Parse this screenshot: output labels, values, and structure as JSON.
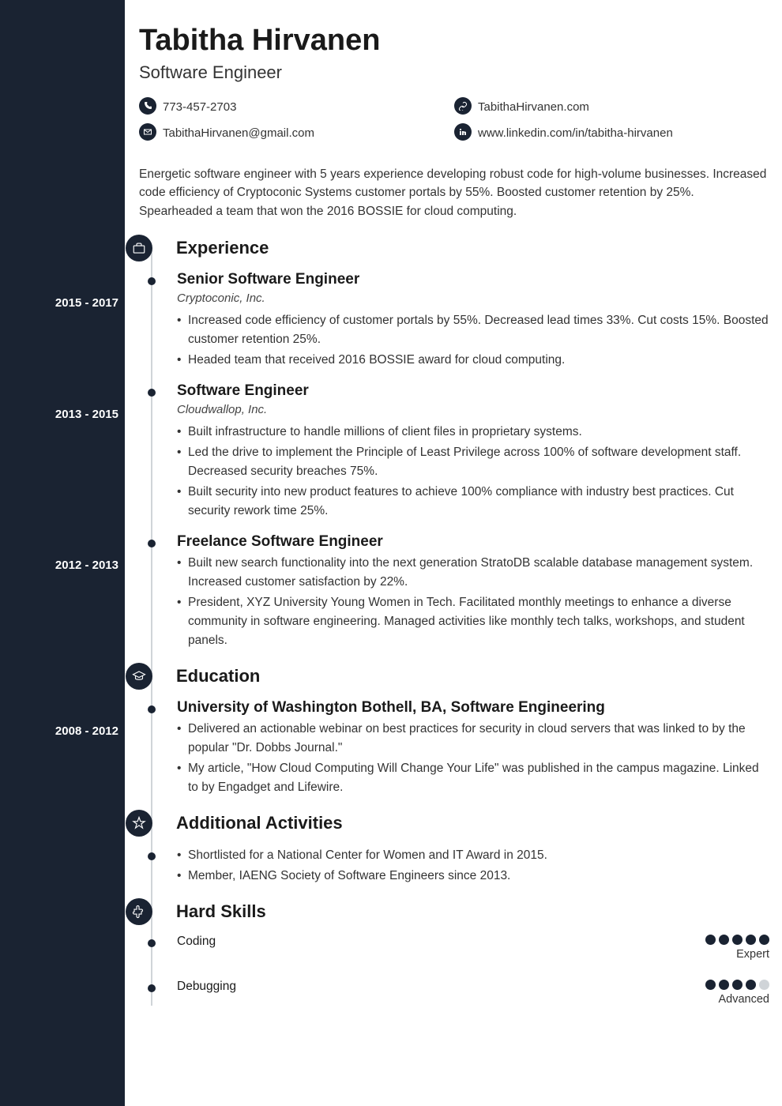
{
  "name": "Tabitha Hirvanen",
  "title": "Software Engineer",
  "contacts": {
    "phone": "773-457-2703",
    "website": "TabithaHirvanen.com",
    "email": "TabithaHirvanen@gmail.com",
    "linkedin": "www.linkedin.com/in/tabitha-hirvanen"
  },
  "summary": "Energetic software engineer with 5 years experience developing robust code for high-volume businesses. Increased code efficiency of Cryptoconic Systems customer portals by 55%. Boosted customer retention by 25%. Spearheaded a team that won the 2016 BOSSIE for cloud computing.",
  "sections": {
    "experience": {
      "title": "Experience",
      "items": [
        {
          "dates": "2015 - 2017",
          "title": "Senior Software Engineer",
          "sub": "Cryptoconic, Inc.",
          "bullets": [
            "Increased code efficiency of customer portals by 55%. Decreased lead times 33%. Cut costs 15%. Boosted customer retention 25%.",
            "Headed team that received 2016 BOSSIE award for cloud computing."
          ]
        },
        {
          "dates": "2013 - 2015",
          "title": "Software Engineer",
          "sub": "Cloudwallop, Inc.",
          "bullets": [
            "Built infrastructure to handle millions of client files in proprietary systems.",
            "Led the drive to implement the Principle of Least Privilege across 100% of software development staff. Decreased security breaches 75%.",
            "Built security into new product features to achieve 100% compliance with industry best practices. Cut security rework time 25%."
          ]
        },
        {
          "dates": "2012 - 2013",
          "title": "Freelance Software Engineer",
          "sub": "",
          "bullets": [
            "Built new search functionality into the next generation StratoDB scalable database management system. Increased customer satisfaction by 22%.",
            "President, XYZ University Young Women in Tech. Facilitated monthly meetings to enhance a diverse community in software engineering. Managed activities like monthly tech talks, workshops, and student panels."
          ]
        }
      ]
    },
    "education": {
      "title": "Education",
      "items": [
        {
          "dates": "2008 - 2012",
          "title": "University of Washington Bothell, BA, Software Engineering",
          "bullets": [
            "Delivered an actionable webinar on best practices for security in cloud servers that was linked to by the popular \"Dr. Dobbs Journal.\"",
            "My article, \"How Cloud Computing Will Change Your Life\" was published in the campus magazine. Linked to by Engadget and Lifewire."
          ]
        }
      ]
    },
    "activities": {
      "title": "Additional Activities",
      "bullets": [
        "Shortlisted for a National Center for Women and IT Award in 2015.",
        "Member, IAENG Society of Software Engineers since 2013."
      ]
    },
    "skills": {
      "title": "Hard Skills",
      "items": [
        {
          "name": "Coding",
          "level": "Expert",
          "rating": 5
        },
        {
          "name": "Debugging",
          "level": "Advanced",
          "rating": 4
        }
      ]
    }
  }
}
